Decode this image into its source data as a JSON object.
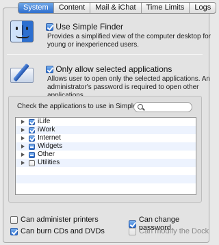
{
  "tabs": [
    "System",
    "Content",
    "Mail & iChat",
    "Time Limits",
    "Logs"
  ],
  "active_tab": "System",
  "simple_finder": {
    "label": "Use Simple Finder",
    "checked": true,
    "description_line1": "Provides a simplified view of the computer desktop for",
    "description_line2": "young or inexperienced users."
  },
  "only_selected": {
    "label": "Only allow selected applications",
    "checked": true,
    "description_line1": "Allows user to open only the selected applications. An",
    "description_line2": "administrator's password is required to open other applications."
  },
  "apps_panel": {
    "label": "Check the applications to use in Simple Finder",
    "search_placeholder": "",
    "items": [
      {
        "label": "iLife",
        "state": "on"
      },
      {
        "label": "iWork",
        "state": "on"
      },
      {
        "label": "Internet",
        "state": "on"
      },
      {
        "label": "Widgets",
        "state": "mixed"
      },
      {
        "label": "Other",
        "state": "mixed"
      },
      {
        "label": "Utilities",
        "state": "off"
      }
    ]
  },
  "bottom_options": {
    "administer_printers": "Can administer printers",
    "change_password": "Can change password",
    "burn_cds": "Can burn CDs and DVDs",
    "modify_dock": "Can modify the Dock"
  },
  "icons": {
    "finder": "finder-icon",
    "apps": "applications-icon",
    "search": "search-icon",
    "disclosure": "disclosure-triangle-icon"
  }
}
